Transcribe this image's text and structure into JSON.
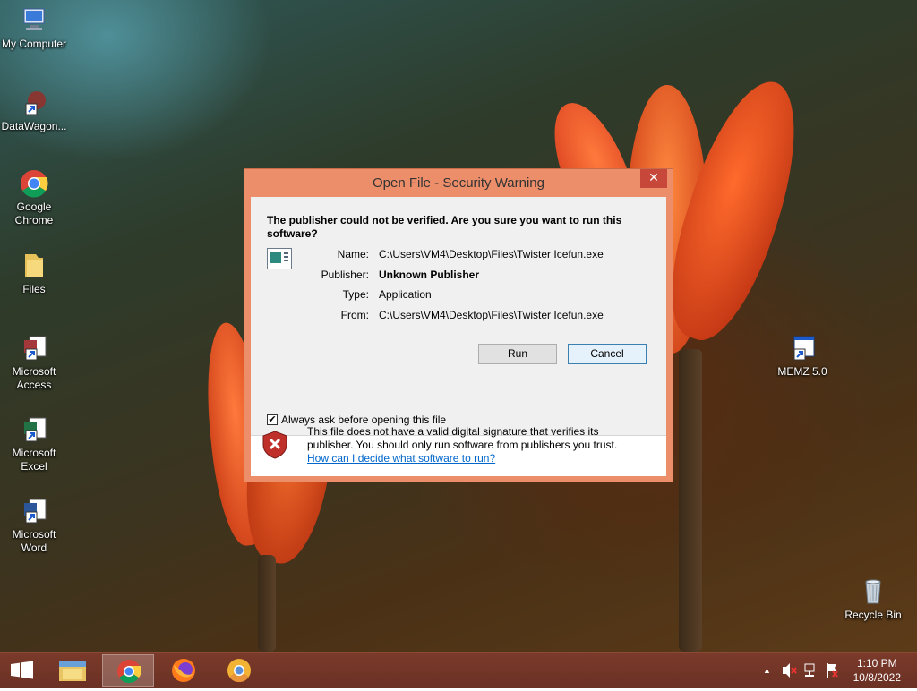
{
  "desktop": {
    "icons": [
      {
        "label": "My Computer",
        "icon": "computer-icon"
      },
      {
        "label": "DataWagon...",
        "icon": "shortcut-icon"
      },
      {
        "label": "Google Chrome",
        "line1": "Google",
        "line2": "Chrome",
        "icon": "chrome-icon"
      },
      {
        "label": "Files",
        "icon": "folder-icon"
      },
      {
        "label": "Microsoft Access",
        "line1": "Microsoft",
        "line2": "Access",
        "icon": "access-icon"
      },
      {
        "label": "Microsoft Excel",
        "line1": "Microsoft",
        "line2": "Excel",
        "icon": "excel-icon"
      },
      {
        "label": "Microsoft Word",
        "line1": "Microsoft",
        "line2": "Word",
        "icon": "word-icon"
      },
      {
        "label": "MEMZ 5.0",
        "icon": "application-icon"
      },
      {
        "label": "Recycle Bin",
        "icon": "recycle-bin-icon"
      }
    ]
  },
  "dialog": {
    "title": "Open File - Security Warning",
    "close_glyph": "✕",
    "heading": "The publisher could not be verified.  Are you sure you want to run this software?",
    "fields": {
      "name_label": "Name:",
      "name_value": "C:\\Users\\VM4\\Desktop\\Files\\Twister Icefun.exe",
      "publisher_label": "Publisher:",
      "publisher_value": "Unknown Publisher",
      "type_label": "Type:",
      "type_value": "Application",
      "from_label": "From:",
      "from_value": "C:\\Users\\VM4\\Desktop\\Files\\Twister Icefun.exe"
    },
    "run_label": "Run",
    "cancel_label": "Cancel",
    "checkbox_label": "Always ask before opening this file",
    "checkbox_checked": true,
    "check_glyph": "✔",
    "warning_text": "This file does not have a valid digital signature that verifies its publisher.  You should only run software from publishers you trust.",
    "help_link": "How can I decide what software to run?"
  },
  "taskbar": {
    "items": [
      "start-icon",
      "file-explorer-icon",
      "chrome-icon",
      "firefox-icon",
      "chromium-icon"
    ],
    "active_item": "chrome-icon",
    "tray_arrow": "▲",
    "time": "1:10 PM",
    "date": "10/8/2022"
  },
  "colors": {
    "dialog_frame": "#ec8e6a",
    "taskbar": "#6a3124",
    "link": "#0066cc",
    "close_button": "#c7483a"
  }
}
